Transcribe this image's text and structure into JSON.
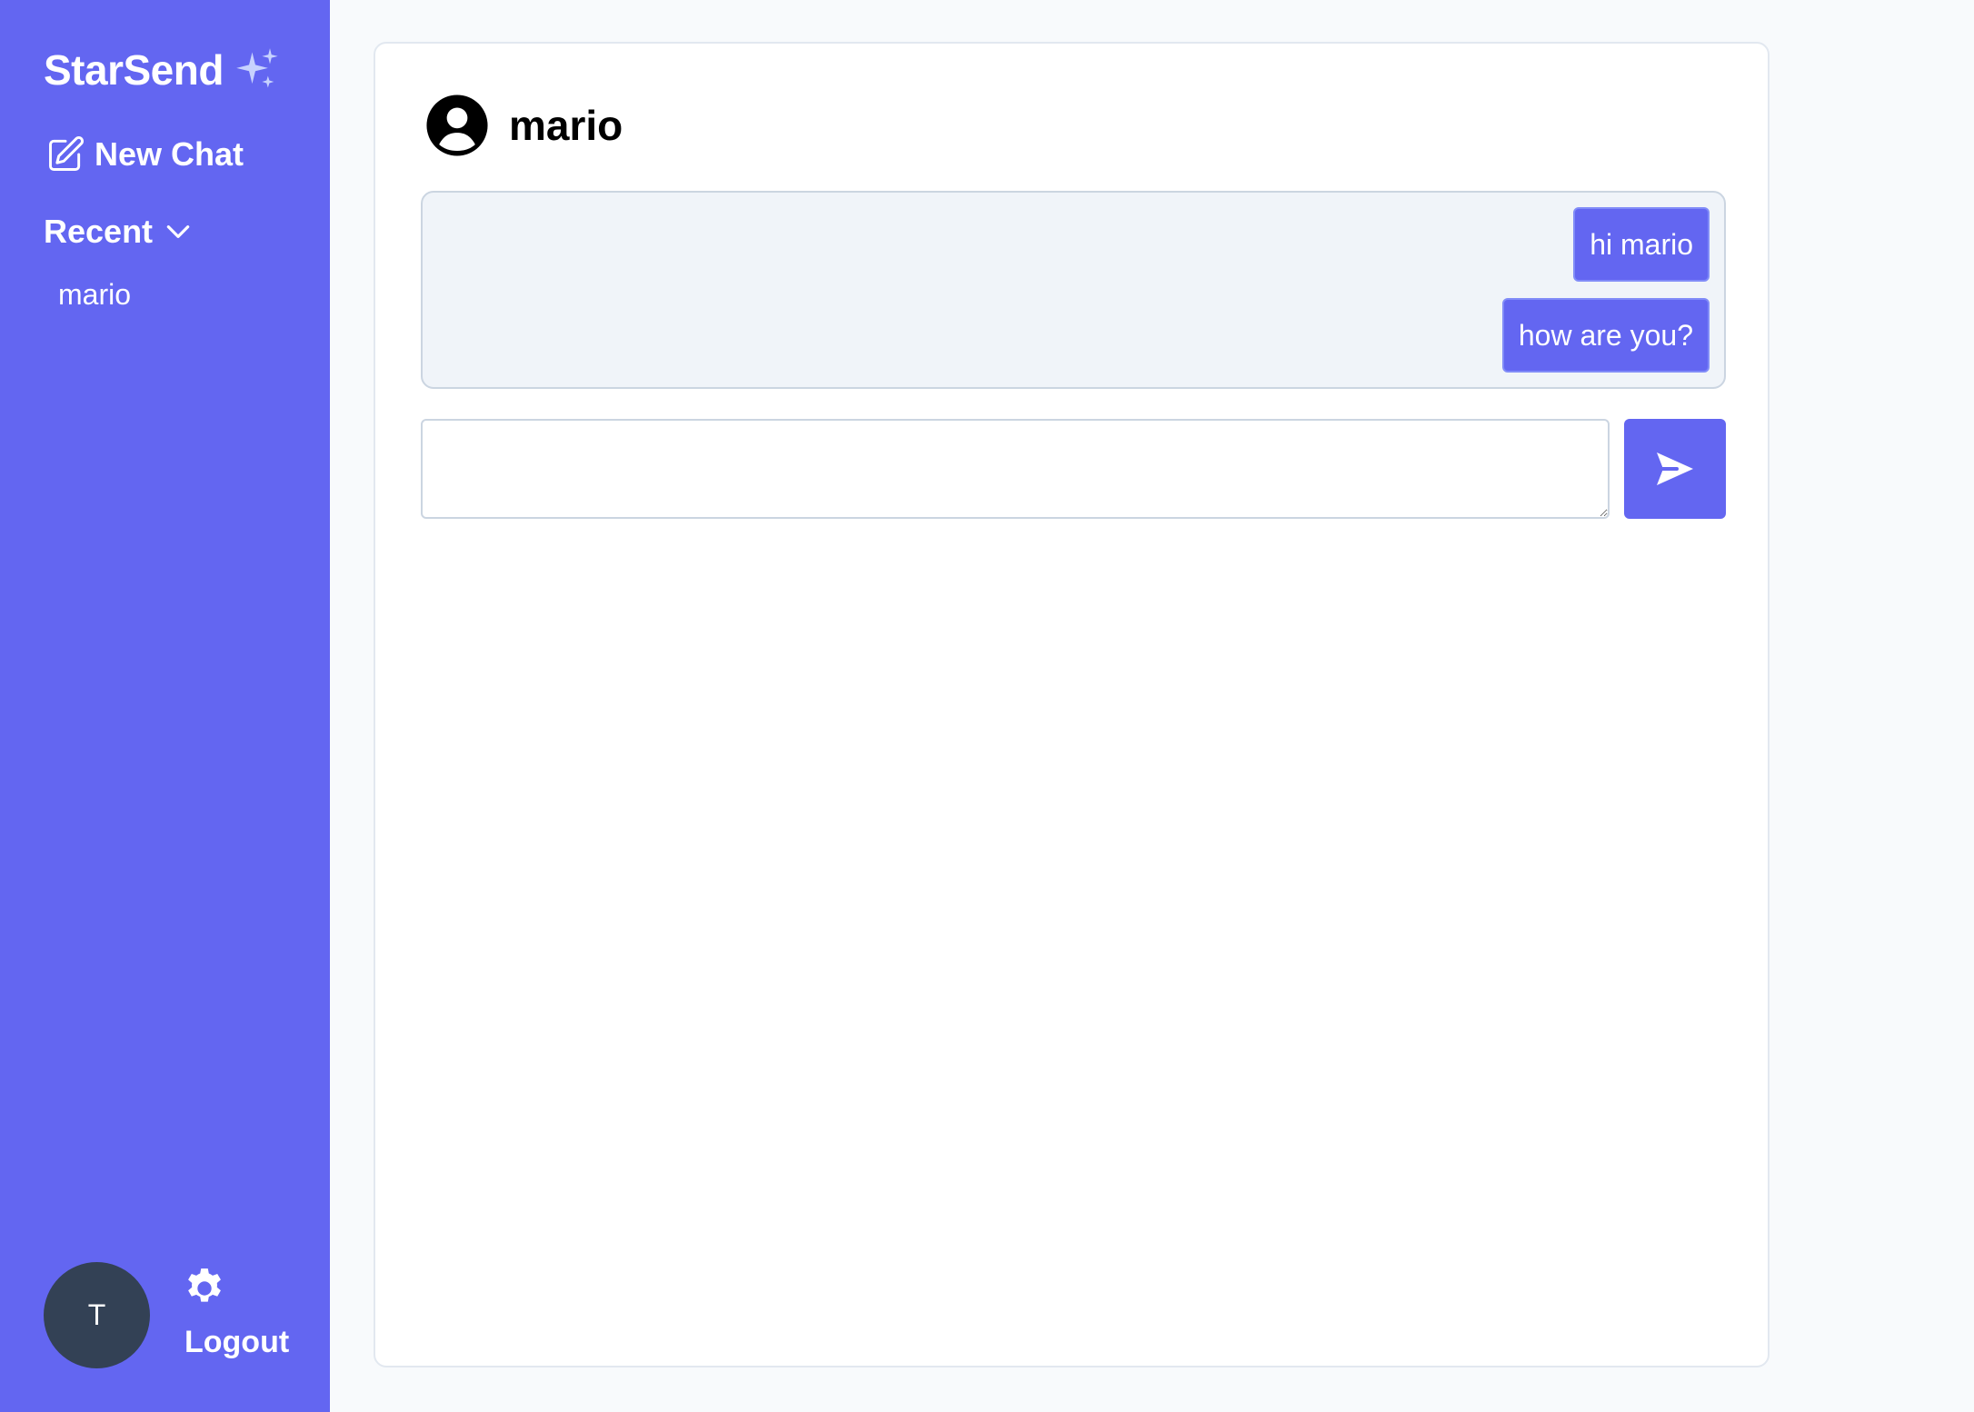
{
  "sidebar": {
    "brand": "StarSend",
    "brand_icon": "sparkles-icon",
    "new_chat_label": "New Chat",
    "new_chat_icon": "pencil-square-icon",
    "recent_label": "Recent",
    "recent_icon": "chevron-down-icon",
    "recent_items": [
      {
        "label": "mario"
      }
    ],
    "avatar_initial": "T",
    "settings_icon": "gear-icon",
    "logout_label": "Logout"
  },
  "chat": {
    "header_icon": "user-circle-icon",
    "contact_name": "mario",
    "messages": [
      {
        "text": "hi mario"
      },
      {
        "text": "how are you?"
      }
    ],
    "composer": {
      "value": "",
      "placeholder": ""
    },
    "send_icon": "paper-plane-icon"
  },
  "colors": {
    "accent": "#6366f1",
    "sidebar_bg": "#6366f1",
    "avatar_bg": "#334155",
    "page_bg": "#f8fafc",
    "messages_bg": "#f0f4f9"
  }
}
